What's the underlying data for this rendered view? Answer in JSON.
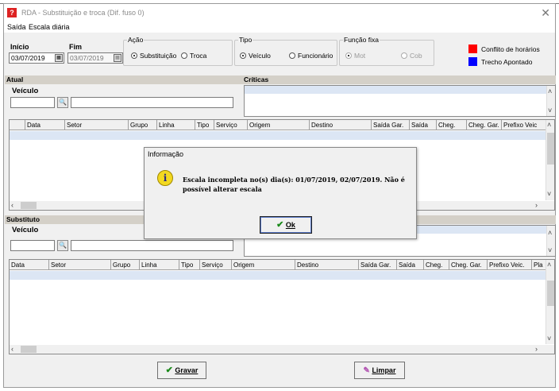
{
  "window": {
    "title": "RDA - Substituição e troca (Dif. fuso 0)"
  },
  "menu": [
    "Saída",
    "Escala diária"
  ],
  "inicio": {
    "label": "Início",
    "value": "03/07/2019"
  },
  "fim": {
    "label": "Fim",
    "value": "03/07/2019"
  },
  "acao": {
    "legend": "Ação",
    "options": [
      "Substituição",
      "Troca"
    ],
    "selected": "Substituição"
  },
  "tipo": {
    "legend": "Tipo",
    "options": [
      "Veículo",
      "Funcionário"
    ],
    "selected": "Veículo"
  },
  "funcao": {
    "legend": "Função fixa",
    "options": [
      "Mot",
      "Cob"
    ]
  },
  "legend_items": [
    {
      "label": "Conflito de horários",
      "color": "#ff0000"
    },
    {
      "label": "Trecho Apontado",
      "color": "#0000ff"
    }
  ],
  "atual": {
    "header": "Atual",
    "field_label": "Veículo"
  },
  "criticas": {
    "header": "Críticas"
  },
  "atual_grid": {
    "columns": [
      "",
      "Data",
      "Setor",
      "Grupo",
      "Linha",
      "Tipo",
      "Serviço",
      "Origem",
      "Destino",
      "Saída Gar.",
      "Saída",
      "Cheg.",
      "Cheg. Gar.",
      "Prefixo Veic"
    ]
  },
  "substituto": {
    "header": "Substituto",
    "field_label": "Veículo"
  },
  "sub_grid": {
    "columns": [
      "Data",
      "Setor",
      "Grupo",
      "Linha",
      "Tipo",
      "Serviço",
      "Origem",
      "Destino",
      "Saída Gar.",
      "Saída",
      "Cheg.",
      "Cheg. Gar.",
      "Prefixo Veic.",
      "Pla"
    ]
  },
  "buttons": {
    "gravar": "Gravar",
    "limpar": "Limpar"
  },
  "dialog": {
    "title": "Informação",
    "message": "Escala incompleta no(s) dia(s): 01/07/2019, 02/07/2019. Não é possível alterar escala",
    "ok": "Ok"
  }
}
